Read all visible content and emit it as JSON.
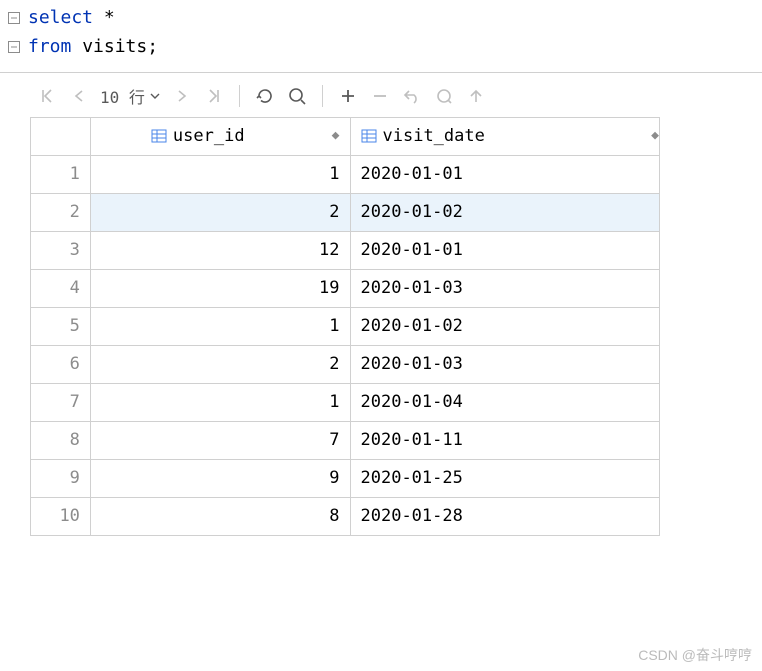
{
  "sql": {
    "line1_keyword": "select",
    "line1_rest": " *",
    "line2_keyword": "from",
    "line2_rest": " visits;"
  },
  "toolbar": {
    "page_label": "10 行"
  },
  "columns": {
    "col1": "user_id",
    "col2": "visit_date"
  },
  "chart_data": {
    "type": "table",
    "columns": [
      "user_id",
      "visit_date"
    ],
    "rows": [
      {
        "n": "1",
        "user_id": "1",
        "visit_date": "2020-01-01"
      },
      {
        "n": "2",
        "user_id": "2",
        "visit_date": "2020-01-02"
      },
      {
        "n": "3",
        "user_id": "12",
        "visit_date": "2020-01-01"
      },
      {
        "n": "4",
        "user_id": "19",
        "visit_date": "2020-01-03"
      },
      {
        "n": "5",
        "user_id": "1",
        "visit_date": "2020-01-02"
      },
      {
        "n": "6",
        "user_id": "2",
        "visit_date": "2020-01-03"
      },
      {
        "n": "7",
        "user_id": "1",
        "visit_date": "2020-01-04"
      },
      {
        "n": "8",
        "user_id": "7",
        "visit_date": "2020-01-11"
      },
      {
        "n": "9",
        "user_id": "9",
        "visit_date": "2020-01-25"
      },
      {
        "n": "10",
        "user_id": "8",
        "visit_date": "2020-01-28"
      }
    ]
  },
  "watermark": "CSDN @奋斗哼哼"
}
